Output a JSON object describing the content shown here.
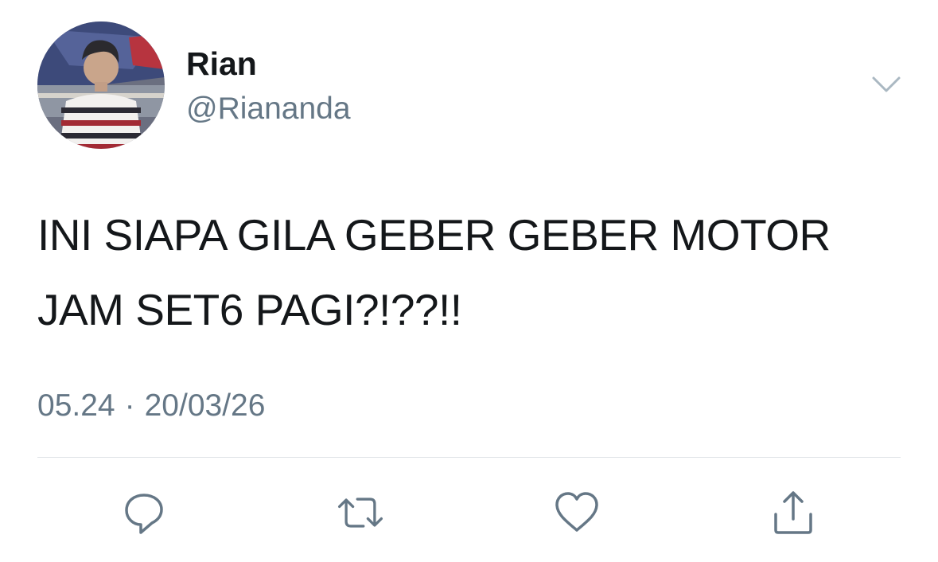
{
  "tweet": {
    "display_name": "Rian",
    "handle": "@Riananda",
    "text_lines": [
      "INI SIAPA GILA GEBER GEBER MOTOR",
      "JAM SET6 PAGI?!??!!"
    ],
    "time": "05.24",
    "separator": "·",
    "date": "20/03/26"
  },
  "icons": {
    "menu": "chevron-down-icon",
    "reply": "reply-icon",
    "retweet": "retweet-icon",
    "like": "heart-icon",
    "share": "share-icon"
  },
  "colors": {
    "text_primary": "#14171a",
    "text_secondary": "#657786",
    "icon": "#657786",
    "divider": "#dfe3e6"
  }
}
